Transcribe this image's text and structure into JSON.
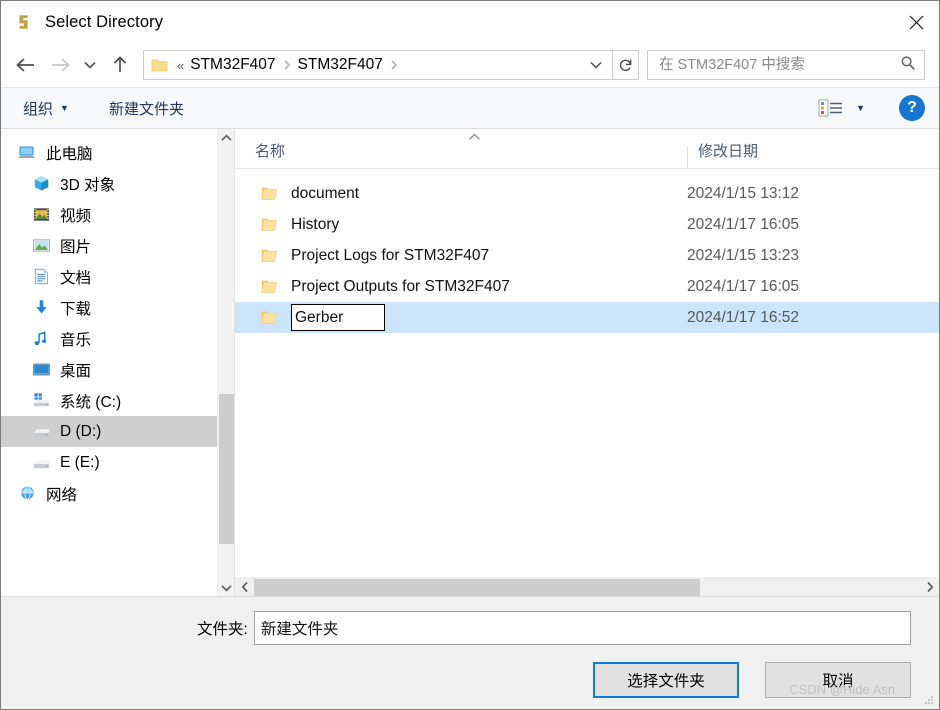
{
  "window": {
    "title": "Select Directory",
    "app_icon": "altium-logo-icon",
    "close_label": "✕"
  },
  "nav": {
    "back": "back-arrow",
    "forward": "forward-arrow",
    "history_dropdown": "chevron-down",
    "up": "up-arrow",
    "breadcrumb": {
      "overflow": "«",
      "parts": [
        "STM32F407",
        "STM32F407"
      ],
      "separator": "›"
    },
    "refresh_label": "↻",
    "address_dropdown": "chevron-down"
  },
  "search": {
    "placeholder": "在 STM32F407 中搜索",
    "value": "",
    "icon": "search-icon"
  },
  "commandbar": {
    "organize": "组织",
    "new_folder": "新建文件夹",
    "view_icon": "view-options-icon",
    "help_label": "?"
  },
  "sidebar": {
    "items": [
      {
        "label": "此电脑",
        "icon": "this-pc-icon",
        "root": true,
        "selected": false
      },
      {
        "label": "3D 对象",
        "icon": "3d-objects-icon",
        "root": false,
        "selected": false
      },
      {
        "label": "视频",
        "icon": "videos-icon",
        "root": false,
        "selected": false
      },
      {
        "label": "图片",
        "icon": "pictures-icon",
        "root": false,
        "selected": false
      },
      {
        "label": "文档",
        "icon": "documents-icon",
        "root": false,
        "selected": false
      },
      {
        "label": "下载",
        "icon": "downloads-icon",
        "root": false,
        "selected": false
      },
      {
        "label": "音乐",
        "icon": "music-icon",
        "root": false,
        "selected": false
      },
      {
        "label": "桌面",
        "icon": "desktop-icon",
        "root": false,
        "selected": false
      },
      {
        "label": "系统 (C:)",
        "icon": "windows-drive-icon",
        "root": false,
        "selected": false
      },
      {
        "label": "D (D:)",
        "icon": "drive-icon",
        "root": false,
        "selected": true
      },
      {
        "label": "E (E:)",
        "icon": "drive-icon",
        "root": false,
        "selected": false
      },
      {
        "label": "网络",
        "icon": "network-icon",
        "root": true,
        "selected": false
      }
    ]
  },
  "filelist": {
    "columns": {
      "name": "名称",
      "date": "修改日期"
    },
    "sort_indicator": "ascending",
    "rows": [
      {
        "name": "document",
        "date": "2024/1/15 13:12",
        "selected": false,
        "editing": false
      },
      {
        "name": "History",
        "date": "2024/1/17 16:05",
        "selected": false,
        "editing": false
      },
      {
        "name": "Project Logs for STM32F407",
        "date": "2024/1/15 13:23",
        "selected": false,
        "editing": false
      },
      {
        "name": "Project Outputs for STM32F407",
        "date": "2024/1/17 16:05",
        "selected": false,
        "editing": false
      },
      {
        "name": "Gerber",
        "date": "2024/1/17 16:52",
        "selected": true,
        "editing": true
      }
    ]
  },
  "footer": {
    "folder_label": "文件夹:",
    "folder_value": "新建文件夹",
    "select_button": "选择文件夹",
    "cancel_button": "取消",
    "watermark": "CSDN @Hide Asn"
  },
  "colors": {
    "selection": "#cce4fa",
    "sidebar_selection": "#cfcfcf",
    "accent": "#0e7bd3",
    "folder_yellow": "#f7d883",
    "command_text": "#1a3560"
  }
}
